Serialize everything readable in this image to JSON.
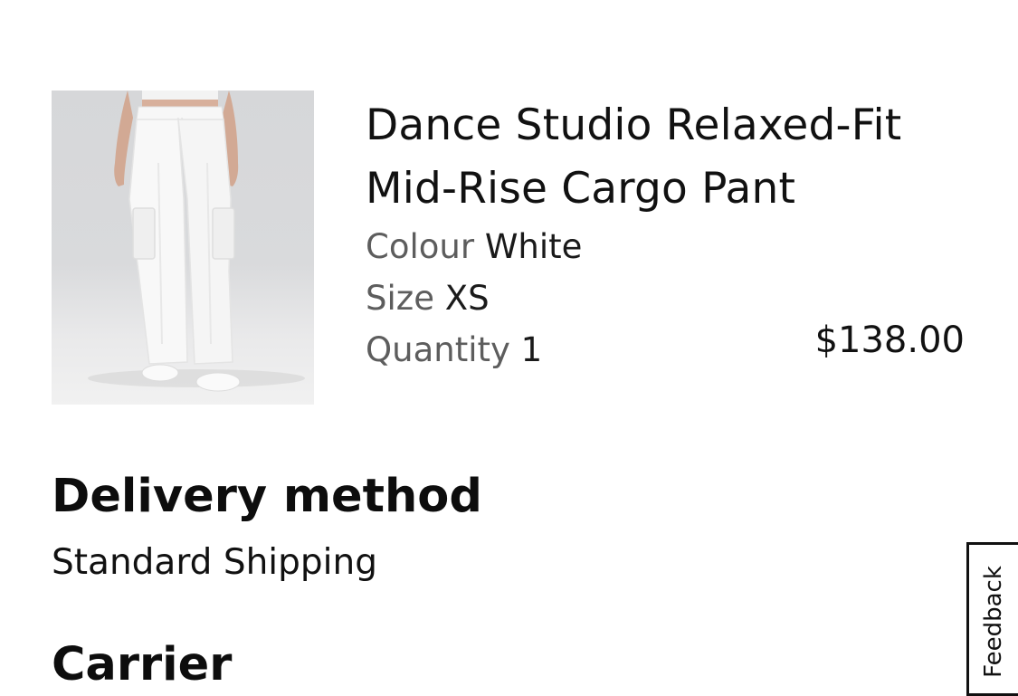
{
  "product": {
    "title": "Dance Studio Relaxed-Fit Mid-Rise Cargo Pant",
    "colour_label": "Colour",
    "colour_value": "White",
    "size_label": "Size",
    "size_value": "XS",
    "quantity_label": "Quantity",
    "quantity_value": "1",
    "price": "$138.00",
    "image_icon": "product-photo-white-cargo-pants"
  },
  "delivery": {
    "heading": "Delivery method",
    "method": "Standard Shipping"
  },
  "carrier": {
    "heading": "Carrier"
  },
  "feedback": {
    "label": "Feedback"
  },
  "colors": {
    "text_primary": "#111111",
    "text_secondary": "#5d5d5d",
    "image_background": "#d9dadc",
    "page_background": "#ffffff"
  }
}
